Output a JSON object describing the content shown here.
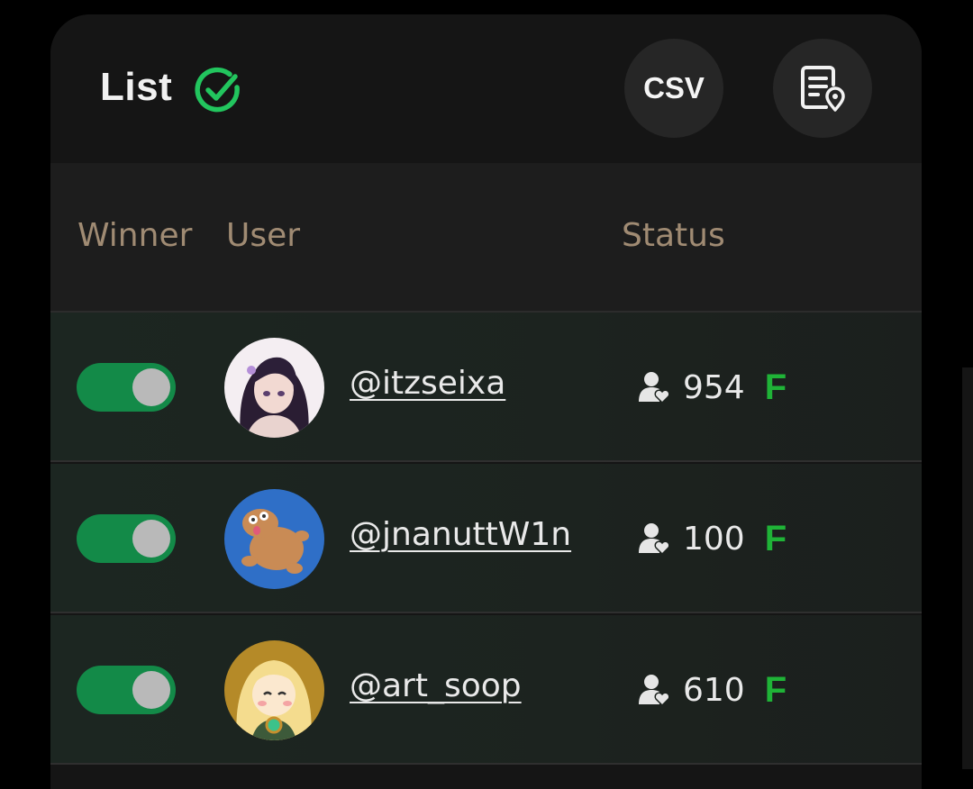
{
  "header": {
    "title": "List",
    "title_icon": "check-circle-icon",
    "csv_label": "CSV",
    "doc_icon": "document-location-icon"
  },
  "columns": {
    "winner": "Winner",
    "user": "User",
    "status": "Status"
  },
  "rows": [
    {
      "winner_on": true,
      "username": "@itzseixa",
      "avatar": "anime-girl-dark-hair-avatar",
      "followers": "954",
      "badge": "F"
    },
    {
      "winner_on": true,
      "username": "@jnanuttW1n",
      "avatar": "capybara-avatar",
      "followers": "100",
      "badge": "F"
    },
    {
      "winner_on": true,
      "username": "@art_soop",
      "avatar": "blonde-character-avatar",
      "followers": "610",
      "badge": "F"
    }
  ],
  "colors": {
    "accent_green": "#1fb337",
    "check_green": "#22c55e",
    "toggle_on": "#138a48",
    "header_text": "#a08b73",
    "background": "#151515"
  }
}
